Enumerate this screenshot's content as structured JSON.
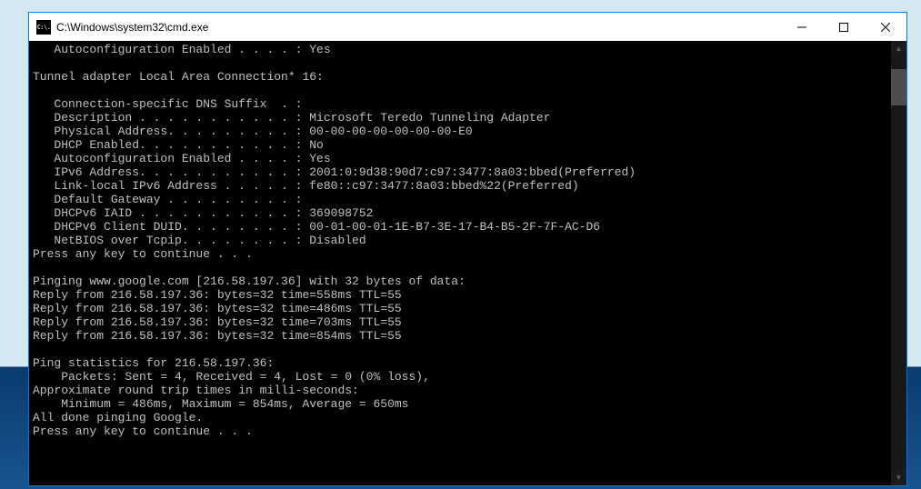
{
  "window": {
    "title": "C:\\Windows\\system32\\cmd.exe",
    "icon_label": "C:\\."
  },
  "console": {
    "lines": [
      "   Autoconfiguration Enabled . . . . : Yes",
      "",
      "Tunnel adapter Local Area Connection* 16:",
      "",
      "   Connection-specific DNS Suffix  . :",
      "   Description . . . . . . . . . . . : Microsoft Teredo Tunneling Adapter",
      "   Physical Address. . . . . . . . . : 00-00-00-00-00-00-00-E0",
      "   DHCP Enabled. . . . . . . . . . . : No",
      "   Autoconfiguration Enabled . . . . : Yes",
      "   IPv6 Address. . . . . . . . . . . : 2001:0:9d38:90d7:c97:3477:8a03:bbed(Preferred)",
      "   Link-local IPv6 Address . . . . . : fe80::c97:3477:8a03:bbed%22(Preferred)",
      "   Default Gateway . . . . . . . . . :",
      "   DHCPv6 IAID . . . . . . . . . . . : 369098752",
      "   DHCPv6 Client DUID. . . . . . . . : 00-01-00-01-1E-B7-3E-17-B4-B5-2F-7F-AC-D6",
      "   NetBIOS over Tcpip. . . . . . . . : Disabled",
      "Press any key to continue . . .",
      "",
      "Pinging www.google.com [216.58.197.36] with 32 bytes of data:",
      "Reply from 216.58.197.36: bytes=32 time=558ms TTL=55",
      "Reply from 216.58.197.36: bytes=32 time=486ms TTL=55",
      "Reply from 216.58.197.36: bytes=32 time=703ms TTL=55",
      "Reply from 216.58.197.36: bytes=32 time=854ms TTL=55",
      "",
      "Ping statistics for 216.58.197.36:",
      "    Packets: Sent = 4, Received = 4, Lost = 0 (0% loss),",
      "Approximate round trip times in milli-seconds:",
      "    Minimum = 486ms, Maximum = 854ms, Average = 650ms",
      "All done pinging Google.",
      "Press any key to continue . . ."
    ]
  }
}
